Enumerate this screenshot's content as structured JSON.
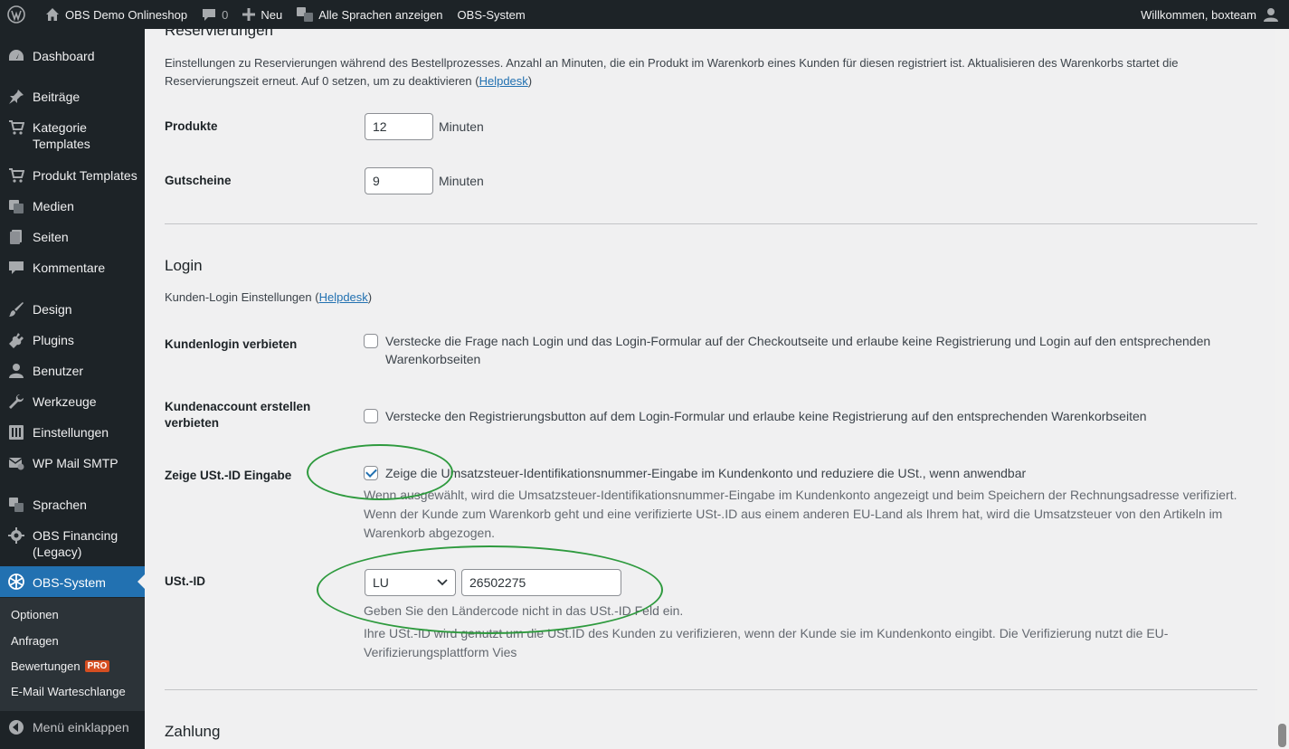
{
  "adminbar": {
    "site_name": "OBS Demo Onlineshop",
    "comments_count": "0",
    "new_label": "Neu",
    "languages_label": "Alle Sprachen anzeigen",
    "obs_label": "OBS-System",
    "welcome": "Willkommen, boxteam"
  },
  "sidebar": {
    "items": [
      {
        "label": "Dashboard",
        "icon": "dashboard-icon"
      },
      {
        "label": "Beiträge",
        "icon": "pin-icon"
      },
      {
        "label": "Kategorie Templates",
        "icon": "cart-icon"
      },
      {
        "label": "Produkt Templates",
        "icon": "cart-icon"
      },
      {
        "label": "Medien",
        "icon": "media-icon"
      },
      {
        "label": "Seiten",
        "icon": "pages-icon"
      },
      {
        "label": "Kommentare",
        "icon": "comment-icon"
      },
      {
        "label": "Design",
        "icon": "brush-icon"
      },
      {
        "label": "Plugins",
        "icon": "plugin-icon"
      },
      {
        "label": "Benutzer",
        "icon": "user-icon"
      },
      {
        "label": "Werkzeuge",
        "icon": "wrench-icon"
      },
      {
        "label": "Einstellungen",
        "icon": "settings-icon"
      },
      {
        "label": "WP Mail SMTP",
        "icon": "mail-icon"
      },
      {
        "label": "Sprachen",
        "icon": "translate-icon"
      },
      {
        "label": "OBS Financing (Legacy)",
        "icon": "gear-icon"
      },
      {
        "label": "OBS-System",
        "icon": "snowflake-icon"
      }
    ],
    "submenu": [
      "Optionen",
      "Anfragen",
      "Bewertungen",
      "E-Mail Warteschlange"
    ],
    "pro_badge": "PRO",
    "collapse_label": "Menü einklappen"
  },
  "reservations": {
    "title": "Reservierungen",
    "description": "Einstellungen zu Reservierungen während des Bestellprozesses. Anzahl an Minuten, die ein Produkt im Warenkorb eines Kunden für diesen registriert ist. Aktualisieren des Warenkorbs startet die Reservierungszeit erneut. Auf 0 setzen, um zu deaktivieren (",
    "helpdesk": "Helpdesk",
    "close_paren": ")",
    "products_label": "Produkte",
    "products_value": "12",
    "vouchers_label": "Gutscheine",
    "vouchers_value": "9",
    "unit": "Minuten"
  },
  "login": {
    "title": "Login",
    "description": "Kunden-Login Einstellungen (",
    "helpdesk": "Helpdesk",
    "close_paren": ")",
    "forbid_login_label": "Kundenlogin verbieten",
    "forbid_login_text": "Verstecke die Frage nach Login und das Login-Formular auf der Checkoutseite und erlaube keine Registrierung und Login auf den entsprechenden Warenkorbseiten",
    "forbid_login_checked": false,
    "forbid_account_label": "Kundenaccount erstellen verbieten",
    "forbid_account_text": "Verstecke den Registrierungsbutton auf dem Login-Formular und erlaube keine Registrierung auf den entsprechenden Warenkorbseiten",
    "forbid_account_checked": false,
    "vat_input_label": "Zeige USt.-ID Eingabe",
    "vat_input_text": "Zeige die Umsatzsteuer-Identifikationsnummer-Eingabe im Kundenkonto und reduziere die USt., wenn anwendbar",
    "vat_input_checked": true,
    "vat_input_help": "Wenn ausgewählt, wird die Umsatzsteuer-Identifikationsnummer-Eingabe im Kundenkonto angezeigt und beim Speichern der Rechnungsadresse verifiziert. Wenn der Kunde zum Warenkorb geht und eine verifizierte USt-.ID aus einem anderen EU-Land als Ihrem hat, wird die Umsatzsteuer von den Artikeln im Warenkorb abgezogen.",
    "vat_id_label": "USt.-ID",
    "vat_country": "LU",
    "vat_number": "26502275",
    "vat_help_1": "Geben Sie den Ländercode nicht in das USt.-ID Feld ein.",
    "vat_help_2": "Ihre USt.-ID wird genutzt um die USt.ID des Kunden zu verifizieren, wenn der Kunde sie im Kundenkonto eingibt. Die Verifizierung nutzt die EU-Verifizierungsplattform Vies"
  },
  "payment": {
    "title": "Zahlung"
  },
  "colors": {
    "sidebar_bg": "#1d2327",
    "accent": "#2271b1",
    "highlight_ellipse": "#2e9a3e"
  }
}
